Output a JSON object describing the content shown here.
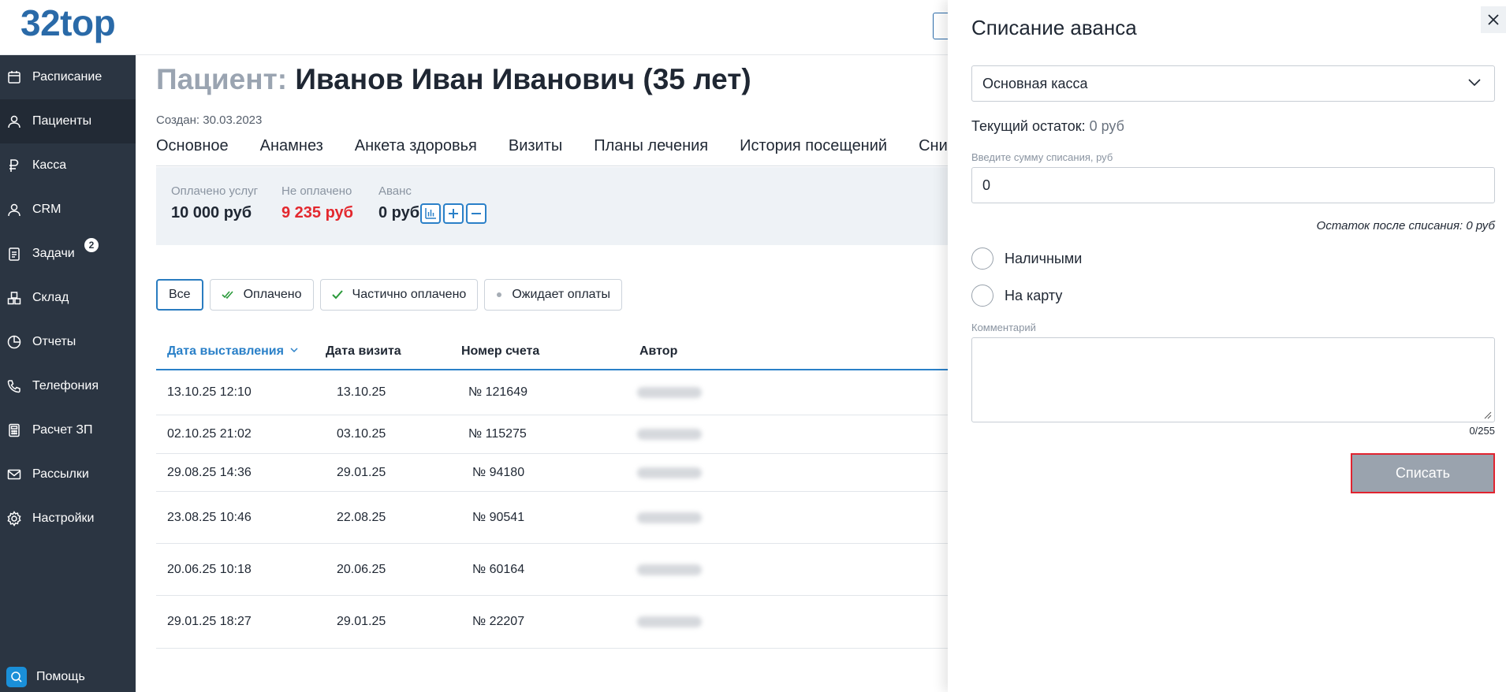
{
  "app": {
    "logo": "32top"
  },
  "sidebar": {
    "items": [
      {
        "label": "Расписание",
        "icon": "calendar-icon"
      },
      {
        "label": "Пациенты",
        "icon": "user-icon"
      },
      {
        "label": "Касса",
        "icon": "ruble-icon"
      },
      {
        "label": "CRM",
        "icon": "user-icon"
      },
      {
        "label": "Задачи",
        "icon": "clipboard-icon",
        "badge": "2"
      },
      {
        "label": "Склад",
        "icon": "boxes-icon"
      },
      {
        "label": "Отчеты",
        "icon": "pie-chart-icon"
      },
      {
        "label": "Телефония",
        "icon": "phone-icon"
      },
      {
        "label": "Расчет ЗП",
        "icon": "calculator-icon"
      },
      {
        "label": "Рассылки",
        "icon": "mail-icon"
      },
      {
        "label": "Настройки",
        "icon": "gear-icon"
      }
    ],
    "active_index": 1,
    "help": {
      "label": "Помощь",
      "icon": "chat-icon"
    }
  },
  "patient": {
    "prefix": "Пациент:",
    "name": "Иванов Иван Иванович (35 лет)",
    "created": "Создан: 30.03.2023"
  },
  "tabs": [
    "Основное",
    "Анамнез",
    "Анкета здоровья",
    "Визиты",
    "Планы лечения",
    "История посещений",
    "Сни"
  ],
  "summary": {
    "paid_label": "Оплачено услуг",
    "paid_value": "10 000 руб",
    "unpaid_label": "Не оплачено",
    "unpaid_value": "9 235 руб",
    "advance_label": "Аванс",
    "advance_value": "0 руб"
  },
  "filters": [
    {
      "label": "Все",
      "icon": ""
    },
    {
      "label": "Оплачено",
      "icon": "double-check-icon"
    },
    {
      "label": "Частично оплачено",
      "icon": "check-icon"
    },
    {
      "label": "Ожидает оплаты",
      "icon": "dot-icon"
    }
  ],
  "table": {
    "headers": [
      "Дата выставления",
      "Дата визита",
      "Номер счета",
      "Автор"
    ],
    "rows": [
      {
        "issued": "13.10.25 12:10",
        "visit": "13.10.25",
        "number": "№ 121649"
      },
      {
        "issued": "02.10.25 21:02",
        "visit": "03.10.25",
        "number": "№ 115275"
      },
      {
        "issued": "29.08.25 14:36",
        "visit": "29.01.25",
        "number": "№ 94180"
      },
      {
        "issued": "23.08.25 10:46",
        "visit": "22.08.25",
        "number": "№ 90541"
      },
      {
        "issued": "20.06.25 10:18",
        "visit": "20.06.25",
        "number": "№ 60164"
      },
      {
        "issued": "29.01.25 18:27",
        "visit": "29.01.25",
        "number": "№ 22207"
      }
    ]
  },
  "panel": {
    "title": "Списание аванса",
    "cashbox": "Основная касса",
    "balance_label": "Текущий остаток:",
    "balance_value": "0 руб",
    "amount_label": "Введите сумму списания, руб",
    "amount_value": "0",
    "after_text": "Остаток после списания: 0 руб",
    "radio_cash": "Наличными",
    "radio_card": "На карту",
    "comment_label": "Комментарий",
    "counter": "0/255",
    "submit": "Списать"
  },
  "colors": {
    "accent": "#2a80c8",
    "sidebar": "#2b3542",
    "red": "#e3282e",
    "submit_bg": "#9aa3ae"
  }
}
